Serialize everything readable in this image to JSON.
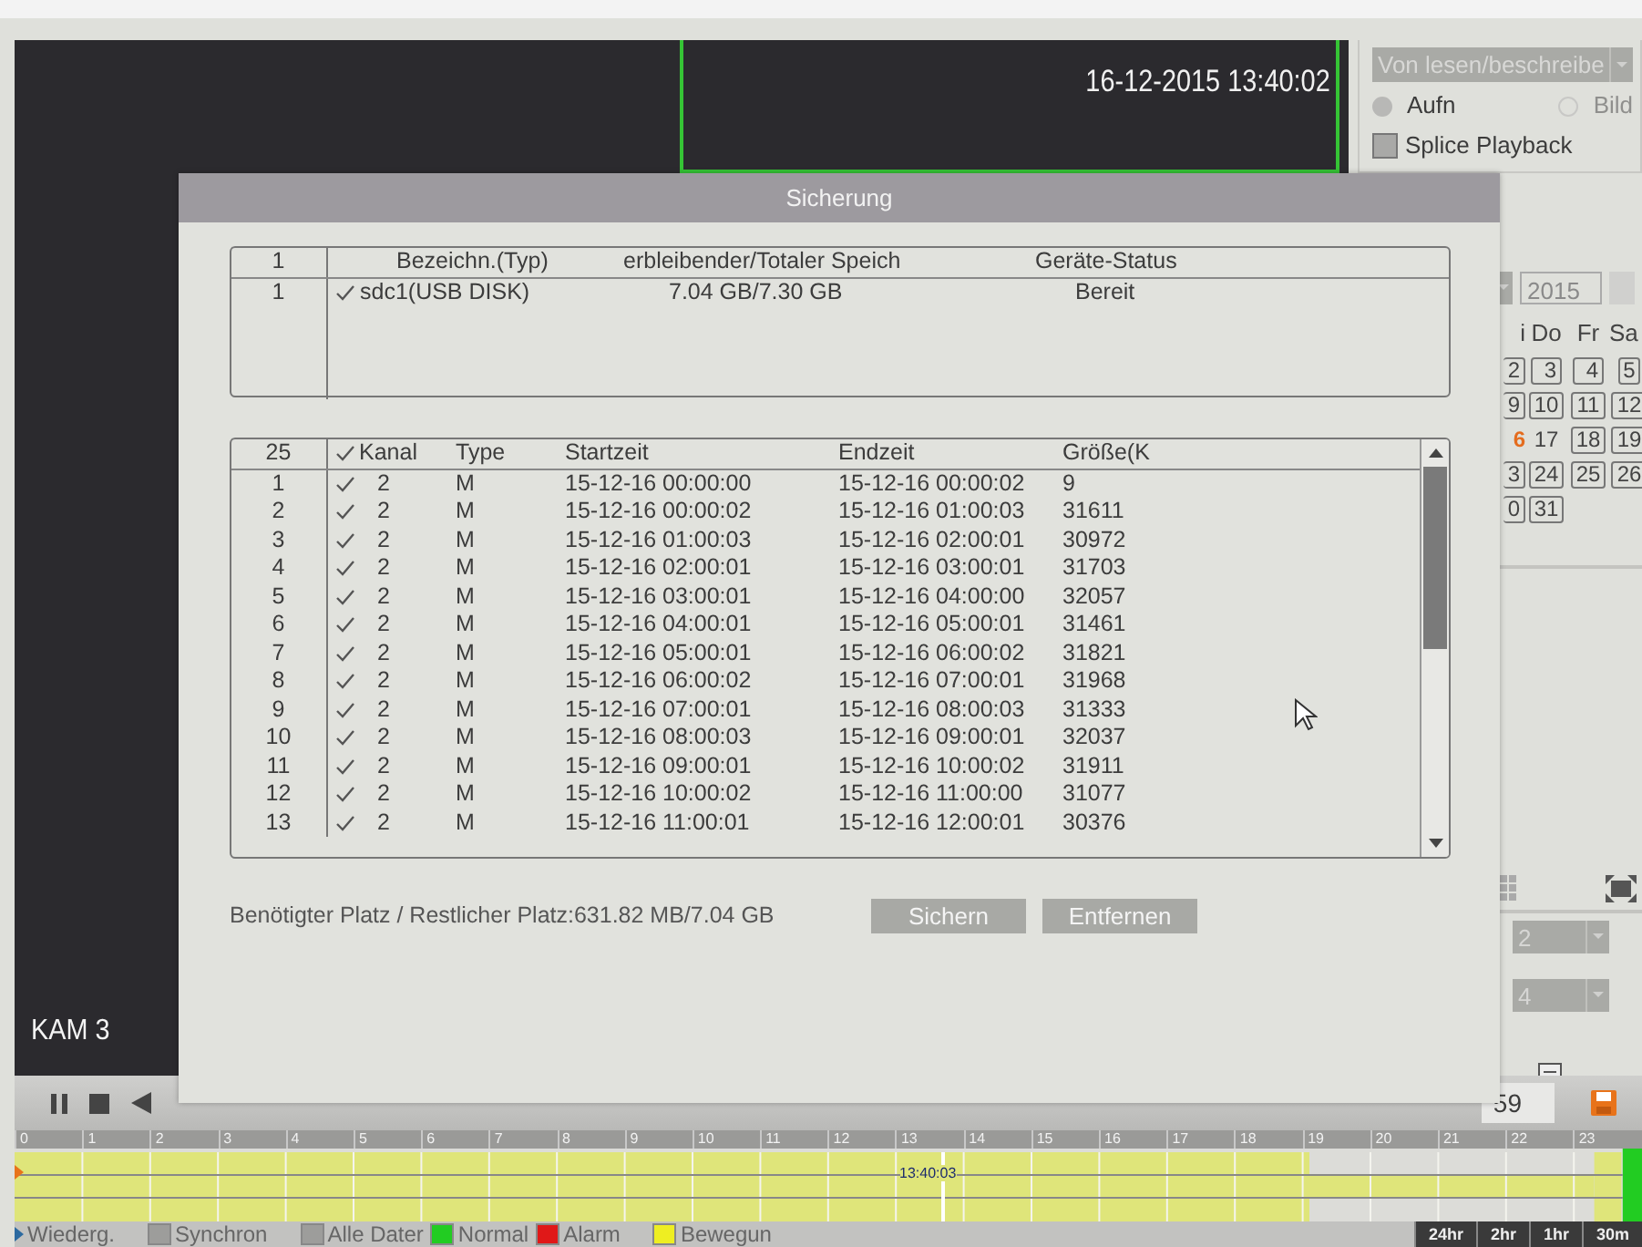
{
  "video": {
    "timestamp": "16-12-2015 13:40:02",
    "channel_label": "KAM 3"
  },
  "side_panel": {
    "mode_dropdown": "Von lesen/beschreibe",
    "radios": [
      {
        "label": "Aufn",
        "selected": true
      },
      {
        "label": "Bild",
        "selected": false
      }
    ],
    "splice_playback": {
      "label": "Splice Playback",
      "checked": false
    },
    "calendar": {
      "year": "2015",
      "weekdays": [
        "i",
        "Do",
        "Fr",
        "Sa"
      ],
      "weeks": [
        [
          {
            "day": "2",
            "has_record": true,
            "selected": false
          },
          {
            "day": "3",
            "has_record": true,
            "selected": false
          },
          {
            "day": "4",
            "has_record": true,
            "selected": false
          },
          {
            "day": "5",
            "has_record": true,
            "selected": false
          }
        ],
        [
          {
            "day": "9",
            "has_record": true,
            "selected": false
          },
          {
            "day": "10",
            "has_record": true,
            "selected": false
          },
          {
            "day": "11",
            "has_record": true,
            "selected": false
          },
          {
            "day": "12",
            "has_record": true,
            "selected": false
          }
        ],
        [
          {
            "day": "6",
            "has_record": false,
            "selected": true
          },
          {
            "day": "17",
            "has_record": false,
            "selected": false
          },
          {
            "day": "18",
            "has_record": true,
            "selected": false
          },
          {
            "day": "19",
            "has_record": true,
            "selected": false
          }
        ],
        [
          {
            "day": "3",
            "has_record": true,
            "selected": false
          },
          {
            "day": "24",
            "has_record": true,
            "selected": false
          },
          {
            "day": "25",
            "has_record": true,
            "selected": false
          },
          {
            "day": "26",
            "has_record": true,
            "selected": false
          }
        ],
        [
          {
            "day": "0",
            "has_record": true,
            "selected": false
          },
          {
            "day": "31",
            "has_record": true,
            "selected": false
          }
        ]
      ]
    },
    "dropdowns": [
      "2",
      "4"
    ]
  },
  "dialog": {
    "title": "Sicherung",
    "devices": {
      "columns": [
        "1",
        "Bezeichn.(Typ)",
        "erbleibender/Totaler Speich",
        "Geräte-Status"
      ],
      "rows": [
        {
          "index": "1",
          "checked": true,
          "name": "sdc1(USB DISK)",
          "space": "7.04 GB/7.30 GB",
          "status": "Bereit"
        }
      ]
    },
    "files": {
      "count": "25",
      "all_checked": true,
      "columns": [
        "Kanal",
        "Type",
        "Startzeit",
        "Endzeit",
        "Größe(K"
      ],
      "rows": [
        {
          "index": "1",
          "checked": true,
          "channel": "2",
          "type": "M",
          "start": "15-12-16 00:00:00",
          "end": "15-12-16 00:00:02",
          "size": "9"
        },
        {
          "index": "2",
          "checked": true,
          "channel": "2",
          "type": "M",
          "start": "15-12-16 00:00:02",
          "end": "15-12-16 01:00:03",
          "size": "31611"
        },
        {
          "index": "3",
          "checked": true,
          "channel": "2",
          "type": "M",
          "start": "15-12-16 01:00:03",
          "end": "15-12-16 02:00:01",
          "size": "30972"
        },
        {
          "index": "4",
          "checked": true,
          "channel": "2",
          "type": "M",
          "start": "15-12-16 02:00:01",
          "end": "15-12-16 03:00:01",
          "size": "31703"
        },
        {
          "index": "5",
          "checked": true,
          "channel": "2",
          "type": "M",
          "start": "15-12-16 03:00:01",
          "end": "15-12-16 04:00:00",
          "size": "32057"
        },
        {
          "index": "6",
          "checked": true,
          "channel": "2",
          "type": "M",
          "start": "15-12-16 04:00:01",
          "end": "15-12-16 05:00:01",
          "size": "31461"
        },
        {
          "index": "7",
          "checked": true,
          "channel": "2",
          "type": "M",
          "start": "15-12-16 05:00:01",
          "end": "15-12-16 06:00:02",
          "size": "31821"
        },
        {
          "index": "8",
          "checked": true,
          "channel": "2",
          "type": "M",
          "start": "15-12-16 06:00:02",
          "end": "15-12-16 07:00:01",
          "size": "31968"
        },
        {
          "index": "9",
          "checked": true,
          "channel": "2",
          "type": "M",
          "start": "15-12-16 07:00:01",
          "end": "15-12-16 08:00:03",
          "size": "31333"
        },
        {
          "index": "10",
          "checked": true,
          "channel": "2",
          "type": "M",
          "start": "15-12-16 08:00:03",
          "end": "15-12-16 09:00:01",
          "size": "32037"
        },
        {
          "index": "11",
          "checked": true,
          "channel": "2",
          "type": "M",
          "start": "15-12-16 09:00:01",
          "end": "15-12-16 10:00:02",
          "size": "31911"
        },
        {
          "index": "12",
          "checked": true,
          "channel": "2",
          "type": "M",
          "start": "15-12-16 10:00:02",
          "end": "15-12-16 11:00:00",
          "size": "31077"
        },
        {
          "index": "13",
          "checked": true,
          "channel": "2",
          "type": "M",
          "start": "15-12-16 11:00:01",
          "end": "15-12-16 12:00:01",
          "size": "30376"
        }
      ]
    },
    "summary": "Benötigter Platz / Restlicher Platz:631.82 MB/7.04 GB",
    "buttons": [
      "Sichern",
      "Entfernen"
    ]
  },
  "playback_bar": {
    "end_time": "59"
  },
  "timeline": {
    "hours": [
      "0",
      "1",
      "2",
      "3",
      "4",
      "5",
      "6",
      "7",
      "8",
      "9",
      "10",
      "11",
      "12",
      "13",
      "14",
      "15",
      "16",
      "17",
      "18",
      "19",
      "20",
      "21",
      "22",
      "23"
    ],
    "cursor_time": "13:40:03"
  },
  "legend": [
    {
      "kind": "toggle",
      "label": "Wiederg."
    },
    {
      "kind": "checkbox",
      "label": "Synchron",
      "checked": false
    },
    {
      "kind": "checkbox",
      "label": "Alle Dater",
      "checked": false
    },
    {
      "kind": "swatch",
      "label": "Normal",
      "color": "#22cc22"
    },
    {
      "kind": "swatch",
      "label": "Alarm",
      "color": "#e01818"
    },
    {
      "kind": "swatch",
      "label": "Bewegun",
      "color": "#eeee22"
    }
  ],
  "zoom_buttons": [
    "24hr",
    "2hr",
    "1hr",
    "30m"
  ]
}
